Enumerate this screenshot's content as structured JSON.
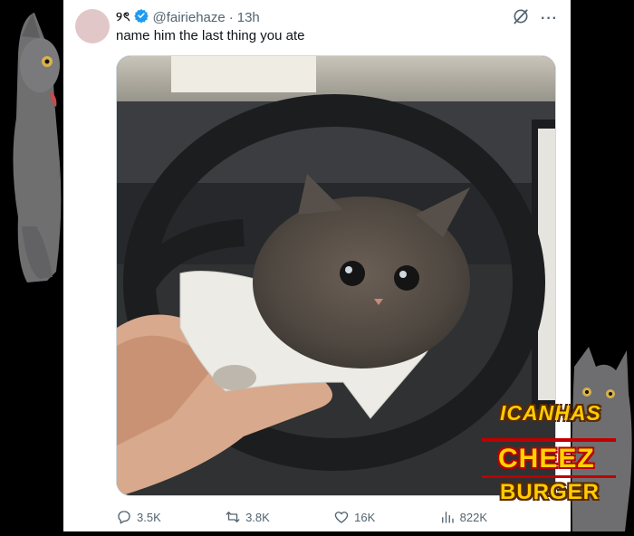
{
  "post": {
    "display_name": "୨ৎ",
    "handle": "@fairiehaze",
    "separator": "·",
    "time": "13h",
    "text": "name him the last thing you ate"
  },
  "actions": {
    "replies": "3.5K",
    "reposts": "3.8K",
    "likes": "16K",
    "views": "822K"
  },
  "icons": [
    "verified-badge-icon",
    "grok-icon",
    "more-icon",
    "reply-icon",
    "repost-icon",
    "like-icon",
    "views-icon"
  ],
  "watermark": {
    "line1": "ICANHAS",
    "line2": "CHEEZ",
    "line3": "BURGER"
  },
  "colors": {
    "verified": "#1d9bf0",
    "secondary_text": "#536471",
    "primary_text": "#0f1419",
    "background": "#000000"
  }
}
